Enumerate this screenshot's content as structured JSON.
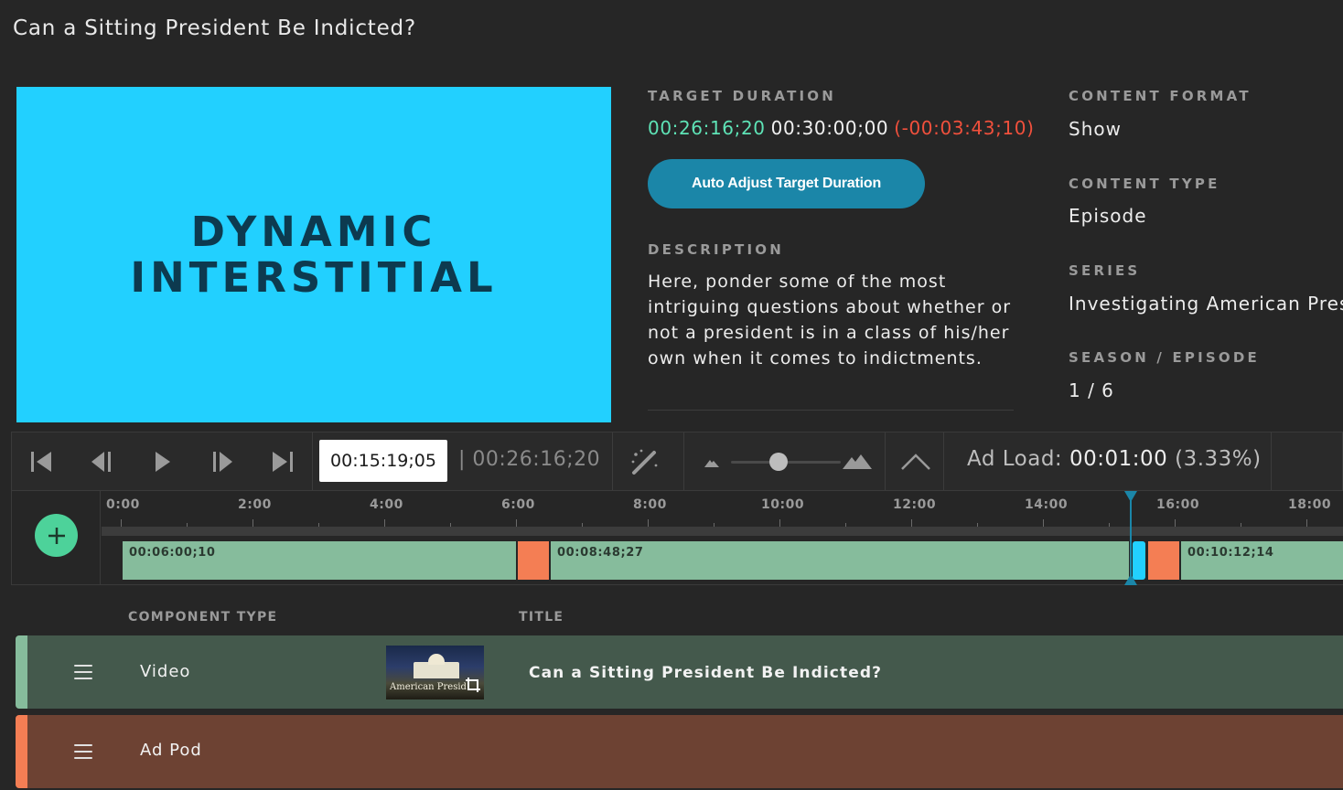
{
  "page": {
    "title": "Can a Sitting President Be Indicted?"
  },
  "preview": {
    "line1": "DYNAMIC",
    "line2": "INTERSTITIAL",
    "background": "#22d0ff"
  },
  "target_duration": {
    "label": "TARGET DURATION",
    "current": "00:26:16;20",
    "target": "00:30:00;00",
    "difference": "(-00:03:43;10)",
    "auto_adjust_label": "Auto Adjust Target Duration"
  },
  "description": {
    "label": "DESCRIPTION",
    "text": "Here, ponder some of the most intriguing questions about whether or not a president is in a class of his/her own when it comes to indictments."
  },
  "meta": {
    "content_format_label": "CONTENT FORMAT",
    "content_format": "Show",
    "content_type_label": "CONTENT TYPE",
    "content_type": "Episode",
    "series_label": "SERIES",
    "series": "Investigating American Presi",
    "season_episode_label": "SEASON / EPISODE",
    "season_episode": "1 / 6"
  },
  "player": {
    "current_time": "00:15:19;05",
    "total_time": "| 00:26:16;20",
    "ad_load_label": "Ad Load:",
    "ad_load_value": "00:01:00",
    "ad_load_pct": "(3.33%)",
    "zoom_level": 0.45
  },
  "timeline": {
    "ruler": [
      "0:00",
      "2:00",
      "4:00",
      "6:00",
      "8:00",
      "10:00",
      "12:00",
      "14:00",
      "16:00",
      "18:00"
    ],
    "segments": [
      {
        "type": "video",
        "label": "00:06:00;10"
      },
      {
        "type": "ad",
        "label": ""
      },
      {
        "type": "video",
        "label": "00:08:48;27"
      },
      {
        "type": "interstitial",
        "label": ""
      },
      {
        "type": "ad",
        "label": ""
      },
      {
        "type": "video",
        "label": "00:10:12;14"
      }
    ]
  },
  "table": {
    "headers": {
      "component_type": "COMPONENT TYPE",
      "title": "TITLE"
    },
    "rows": [
      {
        "type": "Video",
        "title": "Can a Sitting President Be Indicted?",
        "thumb_caption": "American Presid",
        "color": "#86bc9c",
        "bg": "#44594c"
      },
      {
        "type": "Ad Pod",
        "title": "",
        "color": "#f47e54",
        "bg": "#6d4233"
      }
    ]
  },
  "colors": {
    "accent": "#1b86a8",
    "positive": "#5ee3b6",
    "negative": "#f0503c",
    "add": "#4dd29a"
  }
}
